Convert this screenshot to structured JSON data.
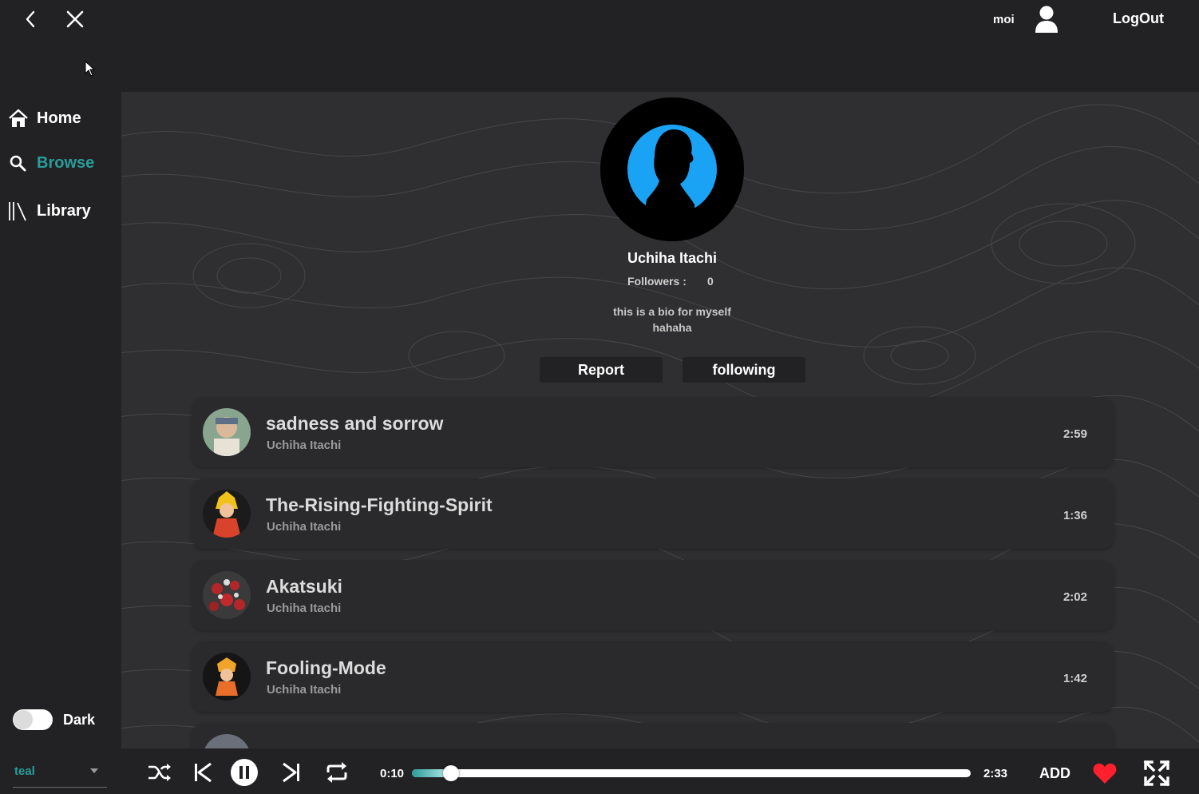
{
  "header": {
    "back_icon": "chevron-left-icon",
    "close_icon": "close-icon",
    "username": "moi",
    "user_icon": "user-icon",
    "logout_label": "LogOut"
  },
  "sidebar": {
    "items": [
      {
        "label": "Home",
        "icon": "home-icon",
        "active": false
      },
      {
        "label": "Browse",
        "icon": "search-icon",
        "active": true
      },
      {
        "label": "Library",
        "icon": "library-icon",
        "active": false
      }
    ],
    "theme_toggle": {
      "label": "Dark",
      "on": false
    }
  },
  "profile": {
    "name": "Uchiha Itachi",
    "followers_label": "Followers :",
    "followers_count": "0",
    "bio_line1": "this is a bio for myself",
    "bio_line2": "hahaha",
    "report_label": "Report",
    "follow_label": "following"
  },
  "tracks": [
    {
      "title": "sadness and sorrow",
      "artist": "Uchiha Itachi",
      "duration": "2:59"
    },
    {
      "title": "The-Rising-Fighting-Spirit",
      "artist": "Uchiha Itachi",
      "duration": "1:36"
    },
    {
      "title": "Akatsuki",
      "artist": "Uchiha Itachi",
      "duration": "2:02"
    },
    {
      "title": "Fooling-Mode",
      "artist": "Uchiha Itachi",
      "duration": "1:42"
    }
  ],
  "player": {
    "theme_value": "teal",
    "current_time": "0:10",
    "total_time": "2:33",
    "progress_fraction": 0.07,
    "add_label": "ADD",
    "liked": true
  },
  "colors": {
    "accent": "#2a9d9b",
    "heart": "#ff1f2d",
    "avatar_ring": "#1aa3f5"
  }
}
